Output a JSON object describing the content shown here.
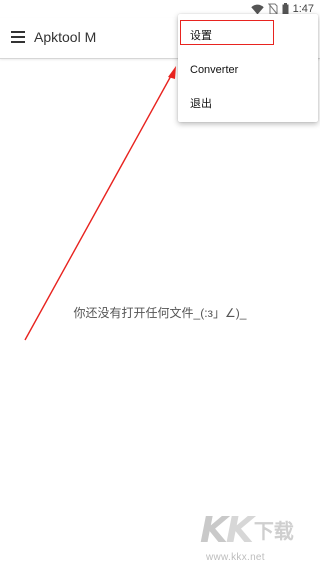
{
  "status_bar": {
    "time": "1:47",
    "icons": [
      "wifi-icon",
      "no-sim-icon",
      "battery-icon"
    ]
  },
  "app_bar": {
    "title": "Apktool M",
    "menu_icon": "hamburger-menu-icon"
  },
  "main": {
    "empty_message": "你还没有打开任何文件_(:з」∠)_"
  },
  "overflow_menu": {
    "items": [
      {
        "label": "设置"
      },
      {
        "label": "Converter"
      },
      {
        "label": "退出"
      }
    ]
  },
  "annotation": {
    "color": "#e8231f",
    "highlighted_item": "设置"
  },
  "watermark": {
    "logo_letters": [
      "K",
      "K"
    ],
    "logo_text": "下载",
    "url": "www.kkx.net"
  },
  "colors": {
    "background": "#ffffff",
    "annotation_red": "#e8231f",
    "text_primary": "#212121",
    "text_secondary": "#555555"
  }
}
